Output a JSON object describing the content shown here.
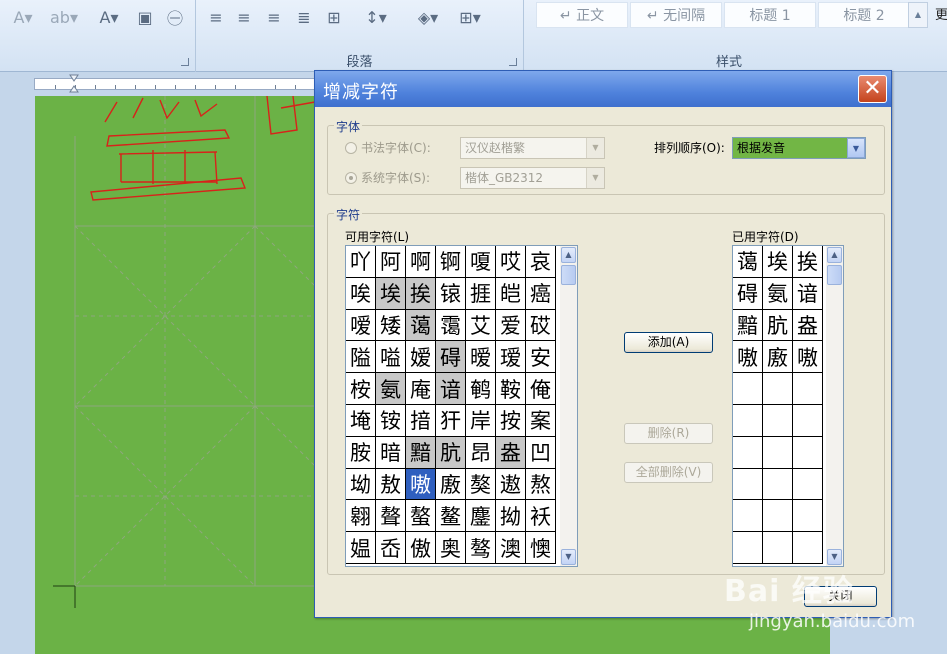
{
  "ribbon": {
    "paragraph_label": "段落",
    "styles_label": "样式",
    "styles": [
      "↵ 正文",
      "↵ 无间隔",
      "标题 1",
      "标题 2"
    ],
    "cut_text": "更"
  },
  "dialog": {
    "title": "增减字符",
    "font_group": {
      "legend": "字体",
      "calligraphy_label": "书法字体(C):",
      "calligraphy_value": "汉仪赵楷繁",
      "system_label": "系统字体(S):",
      "system_value": "楷体_GB2312",
      "sort_label": "排列顺序(O):",
      "sort_value": "根据发音"
    },
    "chars_group": {
      "legend": "字符",
      "available_label": "可用字符(L)",
      "used_label": "已用字符(D)",
      "available": [
        [
          "吖",
          "阿",
          "啊",
          "锕",
          "嗄",
          "哎",
          "哀"
        ],
        [
          "唉",
          "埃",
          "挨",
          "锿",
          "捱",
          "皑",
          "癌"
        ],
        [
          "嗳",
          "矮",
          "蔼",
          "霭",
          "艾",
          "爱",
          "砹"
        ],
        [
          "隘",
          "嗌",
          "嫒",
          "碍",
          "暧",
          "瑷",
          "安"
        ],
        [
          "桉",
          "氨",
          "庵",
          "谙",
          "鹌",
          "鞍",
          "俺"
        ],
        [
          "埯",
          "铵",
          "揞",
          "犴",
          "岸",
          "按",
          "案"
        ],
        [
          "胺",
          "暗",
          "黯",
          "肮",
          "昂",
          "盎",
          "凹"
        ],
        [
          "坳",
          "敖",
          "嗷",
          "廒",
          "獒",
          "遨",
          "熬"
        ],
        [
          "翱",
          "聱",
          "螯",
          "鳌",
          "鏖",
          "拗",
          "袄"
        ],
        [
          "媪",
          "岙",
          "傲",
          "奥",
          "骜",
          "澳",
          "懊"
        ]
      ],
      "used_marks": [
        "1-1",
        "1-2",
        "2-2",
        "3-3",
        "4-1",
        "4-3",
        "6-2",
        "6-3",
        "6-5"
      ],
      "selected": "7-2",
      "used": [
        [
          "蔼",
          "埃",
          "挨"
        ],
        [
          "碍",
          "氨",
          "谙"
        ],
        [
          "黯",
          "肮",
          "盎"
        ],
        [
          "嗷",
          "廒",
          "嗷"
        ],
        [
          "",
          "",
          ""
        ],
        [
          "",
          "",
          ""
        ],
        [
          "",
          "",
          ""
        ],
        [
          "",
          "",
          ""
        ],
        [
          "",
          "",
          ""
        ],
        [
          "",
          "",
          ""
        ]
      ]
    },
    "buttons": {
      "add": "添加(A)",
      "remove": "删除(R)",
      "remove_all": "全部删除(V)",
      "close": "关闭"
    }
  },
  "watermark": {
    "logo": "Bai 经验",
    "url": "jingyan.baidu.com"
  },
  "colors": {
    "doc_bg": "#6bb246",
    "title_bar": "#3e6fce",
    "selected_cell": "#2f5fbf"
  }
}
